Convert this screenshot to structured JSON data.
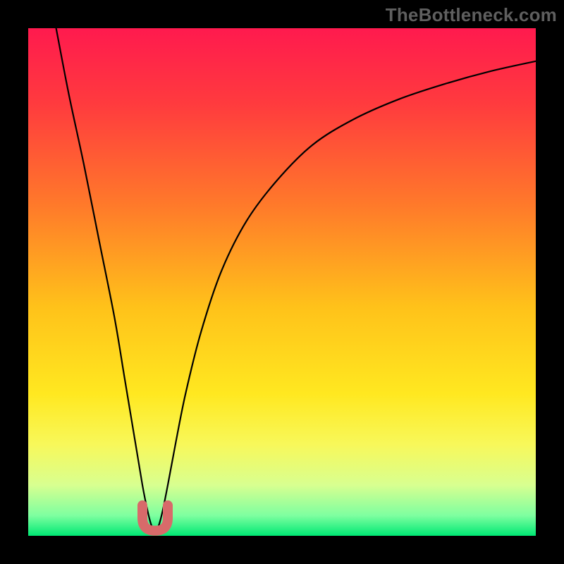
{
  "watermark": "TheBottleneck.com",
  "chart_data": {
    "type": "line",
    "title": "",
    "xlabel": "",
    "ylabel": "",
    "xlim": [
      0,
      100
    ],
    "ylim": [
      0,
      100
    ],
    "x": [
      5.5,
      8,
      11,
      14,
      17,
      19,
      21,
      22.5,
      23.5,
      24.3,
      25,
      25.7,
      26.5,
      27.5,
      29,
      31,
      34,
      38,
      43,
      49,
      56,
      64,
      73,
      82,
      91,
      100
    ],
    "values": [
      100,
      87,
      73,
      58,
      43,
      31,
      19,
      10,
      5,
      2,
      1.2,
      2,
      5,
      10,
      18,
      28,
      40,
      52,
      62,
      70,
      77,
      82,
      86,
      89,
      91.5,
      93.5
    ],
    "gradient_stops": [
      {
        "pos": 0.0,
        "color": "#ff1a4e"
      },
      {
        "pos": 0.15,
        "color": "#ff3b3e"
      },
      {
        "pos": 0.35,
        "color": "#ff7a2a"
      },
      {
        "pos": 0.55,
        "color": "#ffc21a"
      },
      {
        "pos": 0.72,
        "color": "#ffe820"
      },
      {
        "pos": 0.82,
        "color": "#f8f85a"
      },
      {
        "pos": 0.9,
        "color": "#d8ff90"
      },
      {
        "pos": 0.96,
        "color": "#7effa0"
      },
      {
        "pos": 1.0,
        "color": "#00e874"
      }
    ],
    "marker": {
      "shape": "u",
      "color": "#d86a6a",
      "x_range": [
        22.5,
        27.5
      ],
      "y_range": [
        1,
        6
      ]
    }
  }
}
